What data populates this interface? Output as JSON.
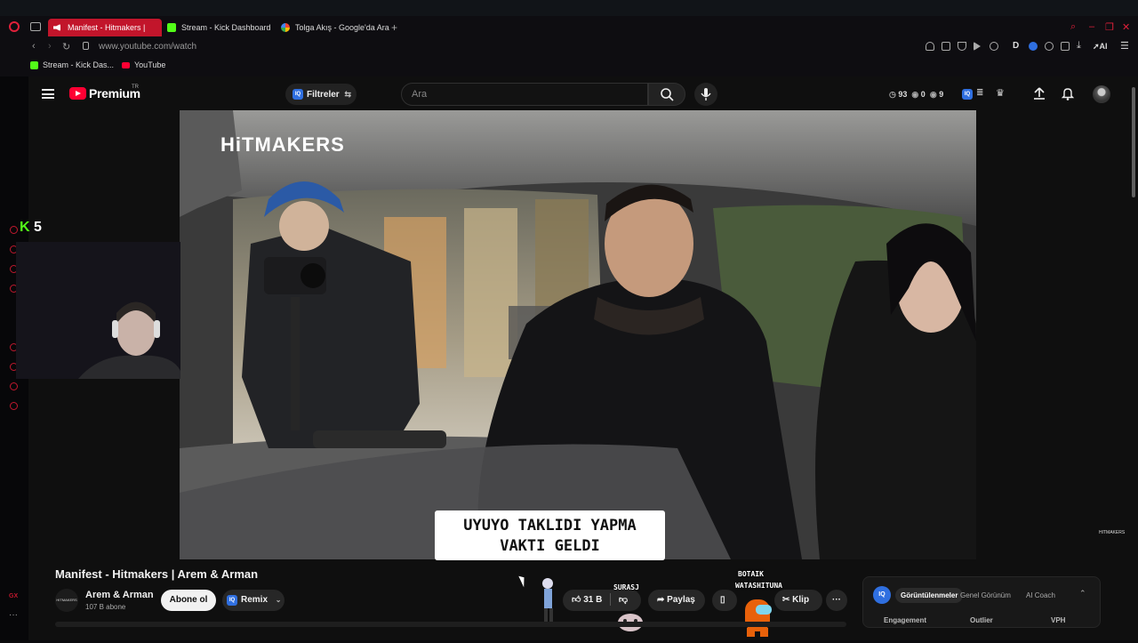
{
  "browser": {
    "tabs": [
      {
        "label": "Manifest - Hitmakers |",
        "active": true
      },
      {
        "label": "Stream - Kick Dashboard",
        "active": false
      },
      {
        "label": "Tolga Akış - Google'da Ara",
        "active": false
      }
    ],
    "url": "www.youtube.com/watch",
    "bookmarks": [
      {
        "label": "Stream - Kick Das..."
      },
      {
        "label": "YouTube"
      }
    ],
    "ext_ai": "AI"
  },
  "youtube": {
    "brand": "Premium",
    "region": "TR",
    "filter_label": "Filtreler",
    "search_placeholder": "Ara",
    "stats": {
      "a": "93",
      "b": "0",
      "c": "9"
    }
  },
  "stream_overlay": {
    "kick_viewers": "5"
  },
  "video": {
    "watermark": "HiTMAKERS",
    "corner_watermark": "HITMAKERS",
    "subtitle_line1": "UYUYO TAKLIDI YAPMA",
    "subtitle_line2": "VAKTI GELDI",
    "title": "Manifest - Hitmakers | Arem & Arman"
  },
  "channel": {
    "name": "Arem & Arman",
    "subscribers": "107 B abone",
    "avatar_text": "HITMAKERS",
    "subscribe_label": "Abone ol",
    "remix_label": "Remix"
  },
  "actions": {
    "likes": "31 B",
    "share": "Paylaş",
    "clip": "Klip"
  },
  "overlay_names": [
    "SURASJ",
    "BOTAIK",
    "WATASHITUNA"
  ],
  "iq_panel": {
    "tabs": [
      "Görüntülenmeler",
      "Genel Görünüm",
      "AI Coach"
    ],
    "columns": [
      "Engagement",
      "Outlier",
      "VPH"
    ]
  },
  "sidebar_bottom": "GX"
}
